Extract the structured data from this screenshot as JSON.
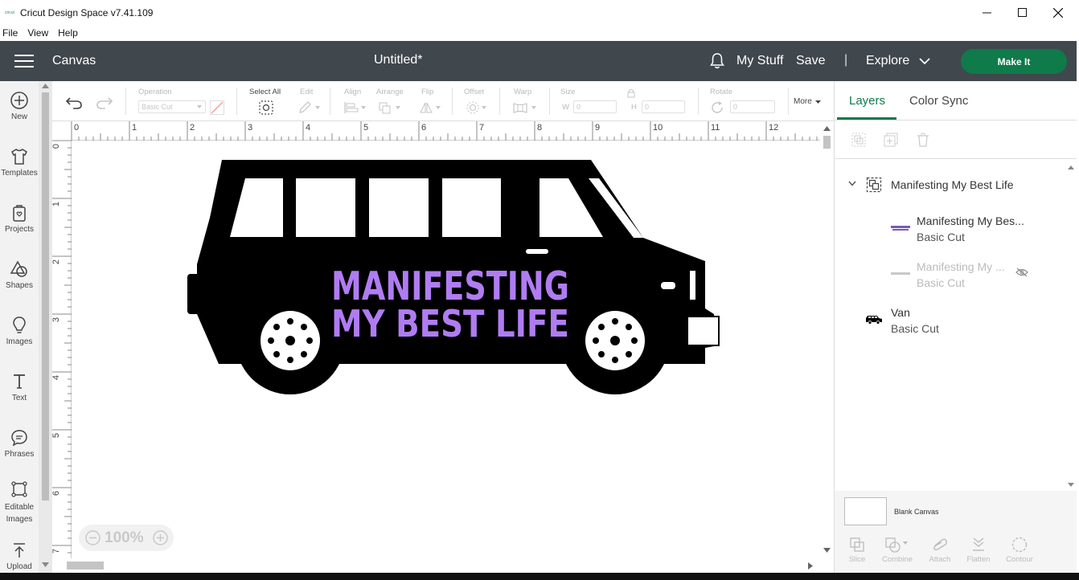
{
  "window": {
    "title": "Cricut Design Space  v7.41.109",
    "logo_text": "cricut"
  },
  "menu": [
    "File",
    "View",
    "Help"
  ],
  "header": {
    "section": "Canvas",
    "document": "Untitled*",
    "my_stuff": "My Stuff",
    "save": "Save",
    "separator": "|",
    "explore": "Explore",
    "make_it": "Make It"
  },
  "sidebar": [
    {
      "label": "New",
      "icon": "plus-circle-icon"
    },
    {
      "label": "Templates",
      "icon": "shirt-icon"
    },
    {
      "label": "Projects",
      "icon": "bag-heart-icon"
    },
    {
      "label": "Shapes",
      "icon": "shapes-icon"
    },
    {
      "label": "Images",
      "icon": "lightbulb-icon"
    },
    {
      "label": "Text",
      "icon": "text-t-icon"
    },
    {
      "label": "Phrases",
      "icon": "speech-bubble-icon"
    },
    {
      "label": "Editable Images",
      "icon": "editable-image-icon"
    },
    {
      "label": "Upload",
      "icon": "upload-icon"
    }
  ],
  "toolbar": {
    "operation_label": "Operation",
    "operation_value": "Basic Cut",
    "select_all": "Select All",
    "edit": "Edit",
    "align": "Align",
    "arrange": "Arrange",
    "flip": "Flip",
    "offset": "Offset",
    "warp": "Warp",
    "size": "Size",
    "w_label": "W",
    "w_value": "0",
    "h_label": "H",
    "h_value": "0",
    "rotate": "Rotate",
    "rotate_value": "0",
    "more": "More"
  },
  "ruler": {
    "top": [
      "0",
      "1",
      "2",
      "3",
      "4",
      "5",
      "6",
      "7",
      "8",
      "9",
      "10",
      "11",
      "12"
    ],
    "left": [
      "0",
      "1",
      "2",
      "3",
      "4",
      "5",
      "6",
      "7"
    ]
  },
  "design": {
    "line1": "MANIFESTING",
    "line2": "MY BEST LIFE",
    "text_color": "#b07cf2",
    "van_color": "#000000"
  },
  "zoom": {
    "value": "100%"
  },
  "panel": {
    "tab_layers": "Layers",
    "tab_color_sync": "Color Sync",
    "accent": "#0f7a4a",
    "group_name": "Manifesting My Best Life",
    "layers": [
      {
        "name": "Manifesting My Bes...",
        "op": "Basic Cut",
        "hidden": false
      },
      {
        "name": "Manifesting My ...",
        "op": "Basic Cut",
        "hidden": true
      },
      {
        "name": "Van",
        "op": "Basic Cut",
        "hidden": false
      }
    ],
    "blank_canvas": "Blank Canvas",
    "bottom_actions": [
      "Slice",
      "Combine",
      "Attach",
      "Flatten",
      "Contour"
    ]
  }
}
